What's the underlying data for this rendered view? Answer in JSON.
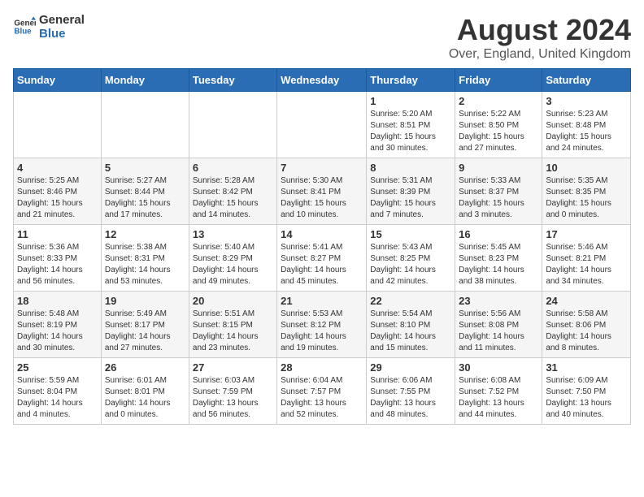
{
  "header": {
    "logo_line1": "General",
    "logo_line2": "Blue",
    "title": "August 2024",
    "subtitle": "Over, England, United Kingdom"
  },
  "weekdays": [
    "Sunday",
    "Monday",
    "Tuesday",
    "Wednesday",
    "Thursday",
    "Friday",
    "Saturday"
  ],
  "weeks": [
    [
      {
        "day": "",
        "info": ""
      },
      {
        "day": "",
        "info": ""
      },
      {
        "day": "",
        "info": ""
      },
      {
        "day": "",
        "info": ""
      },
      {
        "day": "1",
        "info": "Sunrise: 5:20 AM\nSunset: 8:51 PM\nDaylight: 15 hours\nand 30 minutes."
      },
      {
        "day": "2",
        "info": "Sunrise: 5:22 AM\nSunset: 8:50 PM\nDaylight: 15 hours\nand 27 minutes."
      },
      {
        "day": "3",
        "info": "Sunrise: 5:23 AM\nSunset: 8:48 PM\nDaylight: 15 hours\nand 24 minutes."
      }
    ],
    [
      {
        "day": "4",
        "info": "Sunrise: 5:25 AM\nSunset: 8:46 PM\nDaylight: 15 hours\nand 21 minutes."
      },
      {
        "day": "5",
        "info": "Sunrise: 5:27 AM\nSunset: 8:44 PM\nDaylight: 15 hours\nand 17 minutes."
      },
      {
        "day": "6",
        "info": "Sunrise: 5:28 AM\nSunset: 8:42 PM\nDaylight: 15 hours\nand 14 minutes."
      },
      {
        "day": "7",
        "info": "Sunrise: 5:30 AM\nSunset: 8:41 PM\nDaylight: 15 hours\nand 10 minutes."
      },
      {
        "day": "8",
        "info": "Sunrise: 5:31 AM\nSunset: 8:39 PM\nDaylight: 15 hours\nand 7 minutes."
      },
      {
        "day": "9",
        "info": "Sunrise: 5:33 AM\nSunset: 8:37 PM\nDaylight: 15 hours\nand 3 minutes."
      },
      {
        "day": "10",
        "info": "Sunrise: 5:35 AM\nSunset: 8:35 PM\nDaylight: 15 hours\nand 0 minutes."
      }
    ],
    [
      {
        "day": "11",
        "info": "Sunrise: 5:36 AM\nSunset: 8:33 PM\nDaylight: 14 hours\nand 56 minutes."
      },
      {
        "day": "12",
        "info": "Sunrise: 5:38 AM\nSunset: 8:31 PM\nDaylight: 14 hours\nand 53 minutes."
      },
      {
        "day": "13",
        "info": "Sunrise: 5:40 AM\nSunset: 8:29 PM\nDaylight: 14 hours\nand 49 minutes."
      },
      {
        "day": "14",
        "info": "Sunrise: 5:41 AM\nSunset: 8:27 PM\nDaylight: 14 hours\nand 45 minutes."
      },
      {
        "day": "15",
        "info": "Sunrise: 5:43 AM\nSunset: 8:25 PM\nDaylight: 14 hours\nand 42 minutes."
      },
      {
        "day": "16",
        "info": "Sunrise: 5:45 AM\nSunset: 8:23 PM\nDaylight: 14 hours\nand 38 minutes."
      },
      {
        "day": "17",
        "info": "Sunrise: 5:46 AM\nSunset: 8:21 PM\nDaylight: 14 hours\nand 34 minutes."
      }
    ],
    [
      {
        "day": "18",
        "info": "Sunrise: 5:48 AM\nSunset: 8:19 PM\nDaylight: 14 hours\nand 30 minutes."
      },
      {
        "day": "19",
        "info": "Sunrise: 5:49 AM\nSunset: 8:17 PM\nDaylight: 14 hours\nand 27 minutes."
      },
      {
        "day": "20",
        "info": "Sunrise: 5:51 AM\nSunset: 8:15 PM\nDaylight: 14 hours\nand 23 minutes."
      },
      {
        "day": "21",
        "info": "Sunrise: 5:53 AM\nSunset: 8:12 PM\nDaylight: 14 hours\nand 19 minutes."
      },
      {
        "day": "22",
        "info": "Sunrise: 5:54 AM\nSunset: 8:10 PM\nDaylight: 14 hours\nand 15 minutes."
      },
      {
        "day": "23",
        "info": "Sunrise: 5:56 AM\nSunset: 8:08 PM\nDaylight: 14 hours\nand 11 minutes."
      },
      {
        "day": "24",
        "info": "Sunrise: 5:58 AM\nSunset: 8:06 PM\nDaylight: 14 hours\nand 8 minutes."
      }
    ],
    [
      {
        "day": "25",
        "info": "Sunrise: 5:59 AM\nSunset: 8:04 PM\nDaylight: 14 hours\nand 4 minutes."
      },
      {
        "day": "26",
        "info": "Sunrise: 6:01 AM\nSunset: 8:01 PM\nDaylight: 14 hours\nand 0 minutes."
      },
      {
        "day": "27",
        "info": "Sunrise: 6:03 AM\nSunset: 7:59 PM\nDaylight: 13 hours\nand 56 minutes."
      },
      {
        "day": "28",
        "info": "Sunrise: 6:04 AM\nSunset: 7:57 PM\nDaylight: 13 hours\nand 52 minutes."
      },
      {
        "day": "29",
        "info": "Sunrise: 6:06 AM\nSunset: 7:55 PM\nDaylight: 13 hours\nand 48 minutes."
      },
      {
        "day": "30",
        "info": "Sunrise: 6:08 AM\nSunset: 7:52 PM\nDaylight: 13 hours\nand 44 minutes."
      },
      {
        "day": "31",
        "info": "Sunrise: 6:09 AM\nSunset: 7:50 PM\nDaylight: 13 hours\nand 40 minutes."
      }
    ]
  ]
}
